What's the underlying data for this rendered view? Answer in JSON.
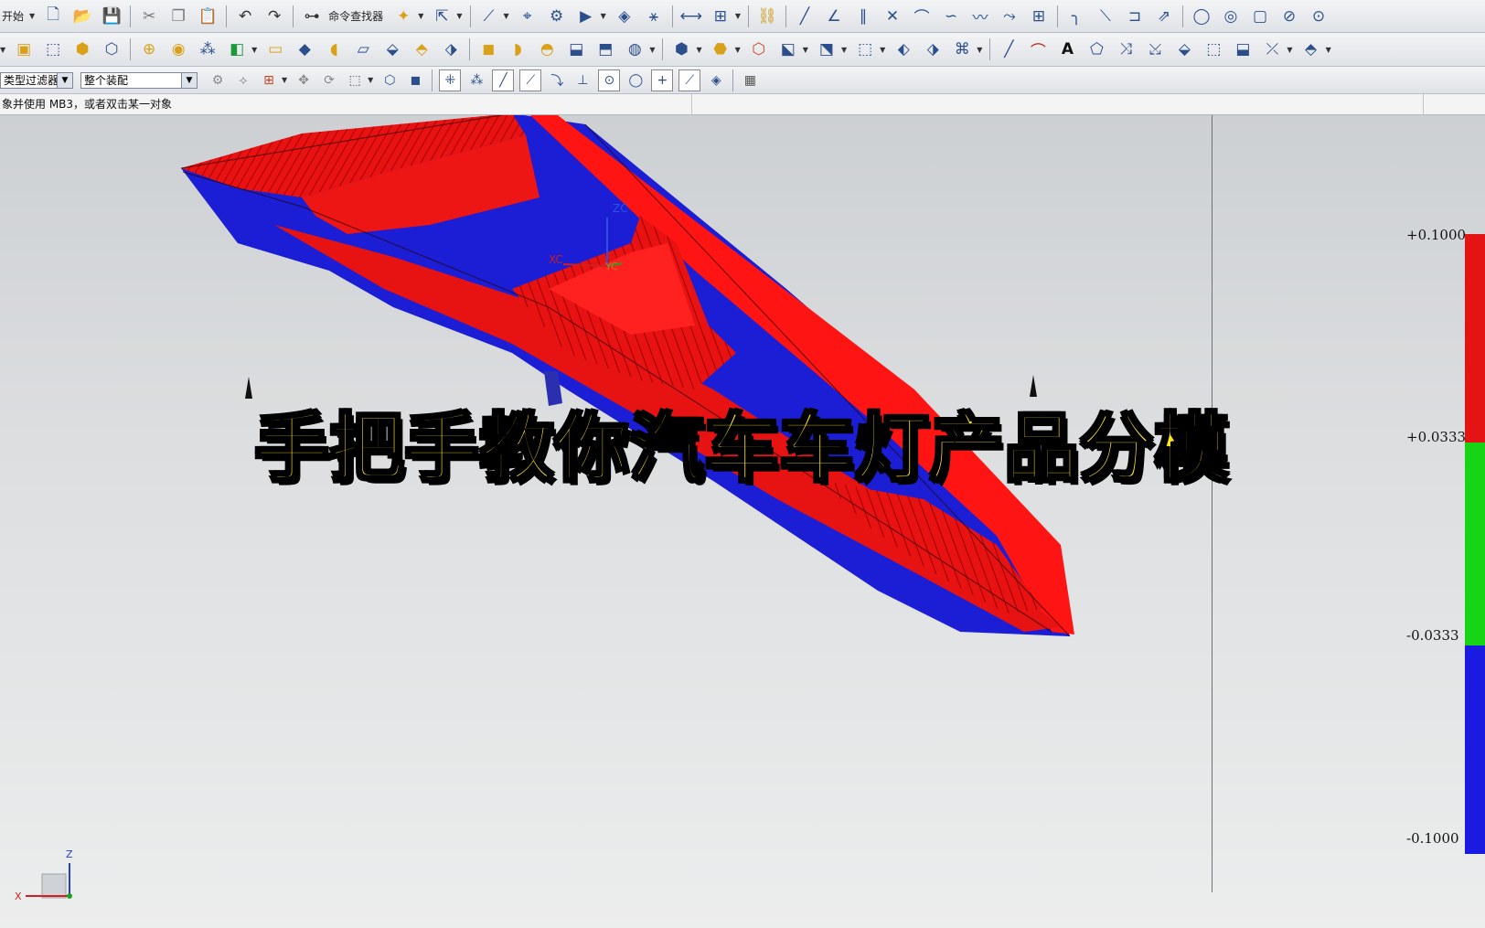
{
  "toolbar": {
    "start_label": "开始",
    "command_finder_label": "命令查找器",
    "row1_icons": [
      "new-file-icon",
      "open-folder-icon",
      "save-icon",
      "cut-icon",
      "copy-icon",
      "paste-icon",
      "undo-icon",
      "redo-icon",
      "binoculars-icon",
      "snap-icon",
      "select-arrow-icon",
      "sketch-icon",
      "wcs-icon",
      "feature-icon",
      "play-icon",
      "point-icon",
      "curve-icon",
      "measure-icon",
      "analysis-icon",
      "line-icon",
      "angle-icon",
      "parallel-icon",
      "perpendicular-icon",
      "arc-icon",
      "spline-icon",
      "circle-icon",
      "fillet-icon",
      "rectangle-icon"
    ],
    "row2_icons": [
      "box-icon",
      "extrude-icon",
      "revolve-icon",
      "sweep-icon",
      "boolean-icon",
      "hole-icon",
      "pattern-icon",
      "mirror-icon",
      "shell-icon",
      "chamfer-icon",
      "blend-icon",
      "trim-icon",
      "offset-icon",
      "draft-icon",
      "cube-icon",
      "assembly-icon",
      "component-icon",
      "constraint-icon",
      "explode-icon",
      "section-icon",
      "view-icon",
      "text-icon",
      "dimension-icon",
      "note-icon"
    ],
    "row3_icons": [
      "filter-icon",
      "snap-point-icon",
      "end-point-icon",
      "mid-point-icon",
      "center-icon",
      "intersect-icon",
      "grid-icon"
    ]
  },
  "filters": {
    "type_filter": "类型过滤器",
    "scope_filter": "整个装配"
  },
  "cue_line": {
    "text": "象并使用 MB3，或者双击某一对象"
  },
  "viewport": {
    "overlay_title": "手把手教你汽车车灯产品分模",
    "wcs_labels": {
      "xc": "XC",
      "yc": "YC",
      "zc": "ZC"
    },
    "triad_labels": {
      "x": "X",
      "z": "Z"
    }
  },
  "legend": {
    "labels": [
      "+0.1000",
      "+0.0333",
      "-0.0333",
      "-0.1000"
    ],
    "colors": [
      "#e41414",
      "#17d417",
      "#1a1ae0"
    ]
  }
}
